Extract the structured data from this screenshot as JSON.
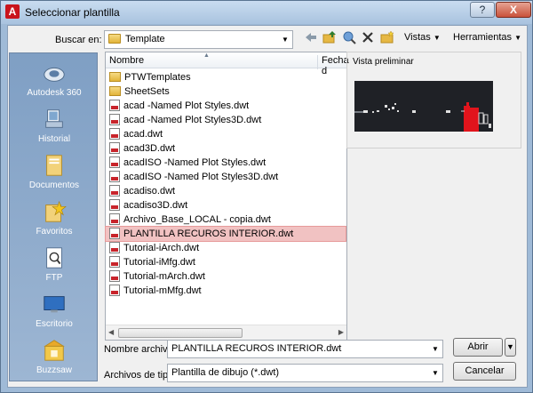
{
  "window": {
    "title": "Seleccionar plantilla",
    "help_label": "?",
    "close_label": "X",
    "app_icon_label": "A"
  },
  "toolbar": {
    "look_in_label": "Buscar en:",
    "look_in_value": "Template",
    "icons": [
      "back-icon",
      "up-folder-icon",
      "search-web-icon",
      "delete-icon",
      "new-folder-icon"
    ],
    "views_label": "Vistas",
    "tools_label": "Herramientas"
  },
  "places": [
    {
      "label": "Autodesk 360",
      "icon": "cloud-icon"
    },
    {
      "label": "Historial",
      "icon": "history-icon"
    },
    {
      "label": "Documentos",
      "icon": "documents-icon"
    },
    {
      "label": "Favoritos",
      "icon": "favorites-icon"
    },
    {
      "label": "FTP",
      "icon": "ftp-icon"
    },
    {
      "label": "Escritorio",
      "icon": "desktop-icon"
    },
    {
      "label": "Buzzsaw",
      "icon": "buzzsaw-icon"
    }
  ],
  "file_list": {
    "columns": [
      "Nombre",
      "Fecha d"
    ],
    "items": [
      {
        "name": "PTWTemplates",
        "type": "folder"
      },
      {
        "name": "SheetSets",
        "type": "folder"
      },
      {
        "name": "acad -Named Plot Styles.dwt",
        "type": "dwt"
      },
      {
        "name": "acad -Named Plot Styles3D.dwt",
        "type": "dwt"
      },
      {
        "name": "acad.dwt",
        "type": "dwt"
      },
      {
        "name": "acad3D.dwt",
        "type": "dwt"
      },
      {
        "name": "acadISO -Named Plot Styles.dwt",
        "type": "dwt"
      },
      {
        "name": "acadISO -Named Plot Styles3D.dwt",
        "type": "dwt"
      },
      {
        "name": "acadiso.dwt",
        "type": "dwt"
      },
      {
        "name": "acadiso3D.dwt",
        "type": "dwt"
      },
      {
        "name": "Archivo_Base_LOCAL - copia.dwt",
        "type": "dwt"
      },
      {
        "name": "PLANTILLA RECUROS INTERIOR.dwt",
        "type": "dwt",
        "selected": true
      },
      {
        "name": "Tutorial-iArch.dwt",
        "type": "dwt"
      },
      {
        "name": "Tutorial-iMfg.dwt",
        "type": "dwt"
      },
      {
        "name": "Tutorial-mArch.dwt",
        "type": "dwt"
      },
      {
        "name": "Tutorial-mMfg.dwt",
        "type": "dwt"
      }
    ]
  },
  "preview": {
    "label": "Vista preliminar"
  },
  "footer": {
    "filename_label": "Nombre archivo:",
    "filename_value": "PLANTILLA RECUROS INTERIOR.dwt",
    "filetype_label": "Archivos de tipo:",
    "filetype_value": "Plantilla de dibujo (*.dwt)",
    "open_label": "Abrir",
    "cancel_label": "Cancelar"
  }
}
